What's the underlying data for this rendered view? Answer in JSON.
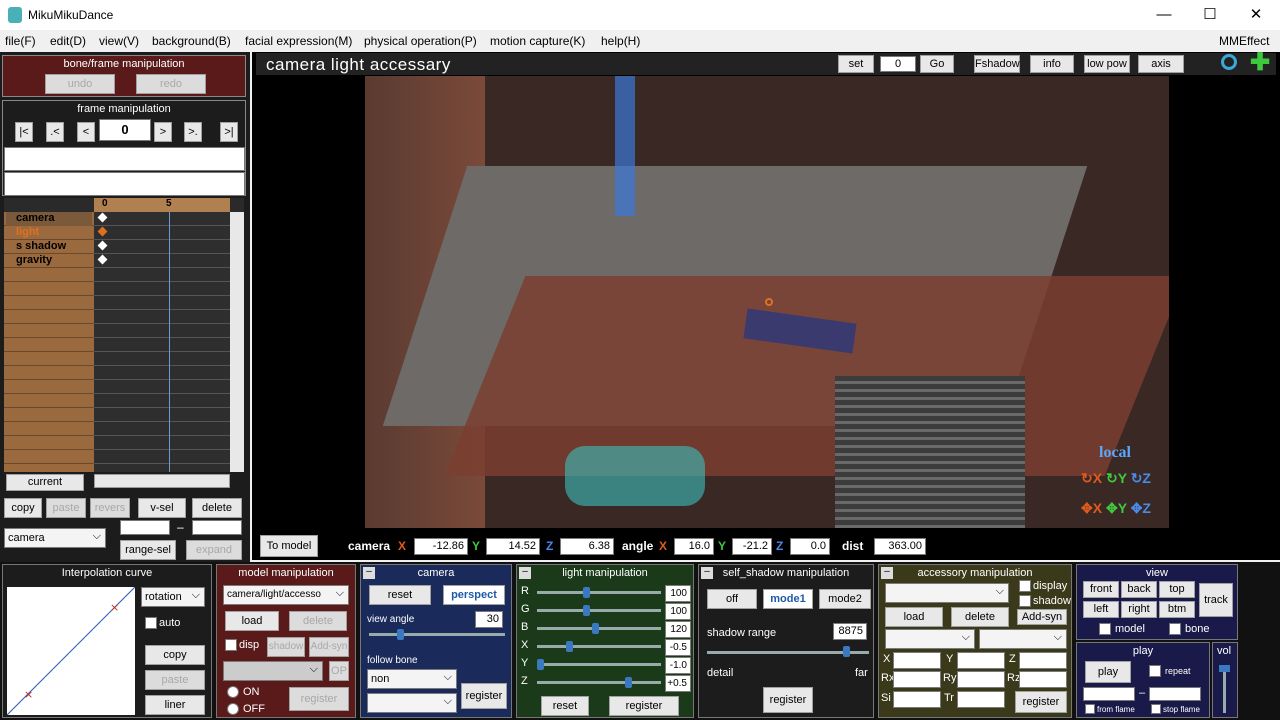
{
  "window": {
    "title": "MikuMikuDance",
    "minimize": "—",
    "maximize": "☐",
    "close": "✕"
  },
  "menu": {
    "items": [
      "file(F)",
      "edit(D)",
      "view(V)",
      "background(B)",
      "facial expression(M)",
      "physical operation(P)",
      "motion capture(K)",
      "help(H)"
    ],
    "mmeffect": "MMEffect"
  },
  "bone_frame": {
    "title": "bone/frame manipulation",
    "undo": "undo",
    "redo": "redo"
  },
  "frame_manip": {
    "title": "frame manipulation",
    "frame": "0",
    "nav": [
      "|<",
      ".<",
      "<",
      ">",
      ">.",
      ">|"
    ]
  },
  "timeline": {
    "ruler": [
      "0",
      "5"
    ],
    "tracks": [
      "camera",
      "light",
      "s shadow",
      "gravity"
    ],
    "current": "current",
    "copy": "copy",
    "paste": "paste",
    "revers": "revers",
    "vsel": "v-sel",
    "delete": "delete",
    "range_sel": "range-sel",
    "expand": "expand",
    "dropdown": "camera",
    "dash": "–"
  },
  "viewport": {
    "title": "camera light accessary",
    "set": "set",
    "frame": "0",
    "go": "Go",
    "fshadow": "Fshadow",
    "info": "info",
    "lowpow": "low pow",
    "axis": "axis",
    "local": "local",
    "tomodel": "To model"
  },
  "camera_readout": {
    "camera": "camera",
    "x": "-12.86",
    "y": "14.52",
    "z": "6.38",
    "angle": "angle",
    "ax": "16.0",
    "ay": "-21.2",
    "az": "0.0",
    "dist": "dist",
    "distv": "363.00",
    "X": "X",
    "Y": "Y",
    "Z": "Z"
  },
  "interp": {
    "title": "Interpolation curve",
    "mode": "rotation",
    "auto": "auto",
    "copy": "copy",
    "paste": "paste",
    "liner": "liner"
  },
  "model_manip": {
    "title": "model manipulation",
    "model": "camera/light/accesso",
    "load": "load",
    "delete": "delete",
    "disp": "disp",
    "shadow": "shadow",
    "addsyn": "Add-syn",
    "op": "OP",
    "on": "ON",
    "off": "OFF",
    "register": "register"
  },
  "camera_panel": {
    "title": "camera",
    "reset": "reset",
    "perspect": "perspect",
    "view_angle": "view angle",
    "angle": "30",
    "follow_bone": "follow bone",
    "bone": "non",
    "register": "register"
  },
  "light_panel": {
    "title": "light manipulation",
    "rows": [
      {
        "k": "R",
        "v": "100",
        "f": 0.39
      },
      {
        "k": "G",
        "v": "100",
        "f": 0.39
      },
      {
        "k": "B",
        "v": "120",
        "f": 0.47
      },
      {
        "k": "X",
        "v": "-0.5",
        "f": 0.25
      },
      {
        "k": "Y",
        "v": "-1.0",
        "f": 0.0
      },
      {
        "k": "Z",
        "v": "+0.5",
        "f": 0.75
      }
    ],
    "reset": "reset",
    "register": "register"
  },
  "shadow_panel": {
    "title": "self_shadow manipulation",
    "off": "off",
    "mode1": "mode1",
    "mode2": "mode2",
    "range": "shadow range",
    "value": "8875",
    "detail": "detail",
    "far": "far",
    "register": "register"
  },
  "accessory": {
    "title": "accessory manipulation",
    "display": "display",
    "shadow": "shadow",
    "load": "load",
    "delete": "delete",
    "addsyn": "Add-syn",
    "register": "register",
    "labels": [
      "X",
      "Y",
      "Z",
      "Rx",
      "Ry",
      "Rz",
      "Si",
      "Tr"
    ]
  },
  "view_panel": {
    "title": "view",
    "front": "front",
    "back": "back",
    "top": "top",
    "left": "left",
    "right": "right",
    "btm": "btm",
    "track": "track",
    "model": "model",
    "bone": "bone"
  },
  "play_panel": {
    "title": "play",
    "play": "play",
    "repeat": "repeat",
    "from": "from flame",
    "stop": "stop flame",
    "vol": "vol",
    "dash": "–"
  }
}
